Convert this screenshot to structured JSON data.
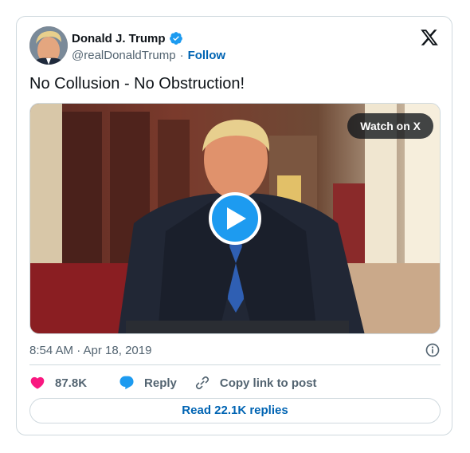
{
  "author": {
    "display_name": "Donald J. Trump",
    "handle": "@realDonaldTrump",
    "separator": "·",
    "follow_label": "Follow",
    "verified_color": "#1d9bf0"
  },
  "tweet": {
    "text": "No Collusion - No Obstruction!"
  },
  "media": {
    "watch_label": "Watch on X",
    "play_icon": "play-icon"
  },
  "meta": {
    "timestamp": "8:54 AM · Apr 18, 2019",
    "info_icon": "info-icon"
  },
  "actions": {
    "like_count": "87.8K",
    "reply_label": "Reply",
    "copy_link_label": "Copy link to post"
  },
  "footer": {
    "read_replies_label": "Read 22.1K replies"
  },
  "colors": {
    "accent": "#1d9bf0",
    "link": "#0064b3",
    "heart": "#f91880",
    "muted": "#536471",
    "border": "#cfd9de"
  }
}
